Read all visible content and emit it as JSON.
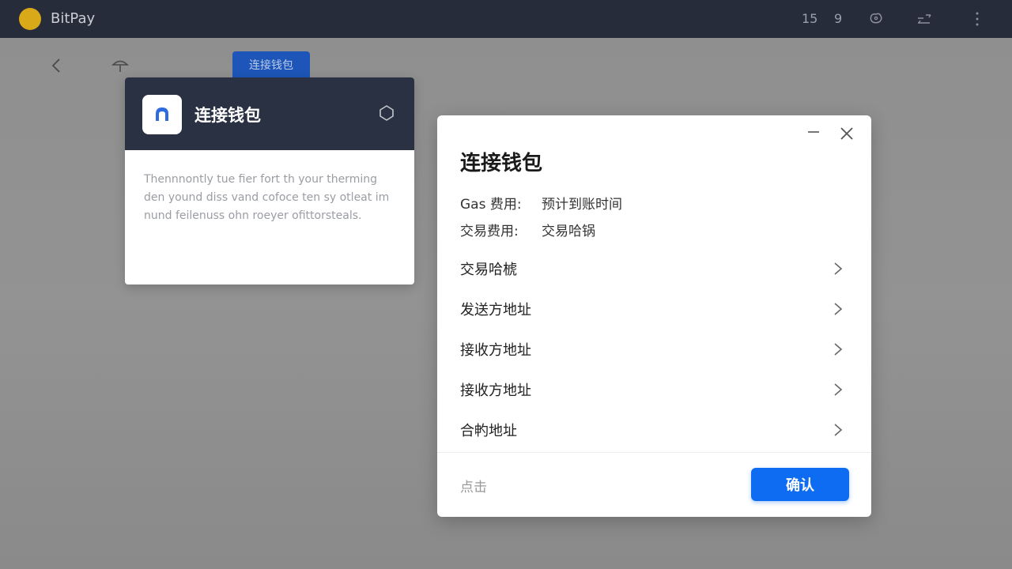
{
  "app": {
    "title": "BitPay",
    "top_num_1": "15",
    "top_num_2": "9",
    "brand_color": "#d9a91a"
  },
  "toolbar": {
    "connect_tab": "连接钱包"
  },
  "left_card": {
    "title": "连接钱包",
    "body_line_1": "Thennnontly tue fier fort th your therming",
    "body_line_2": "den yound diss vand cofoce ten sy otleat im",
    "body_line_3": "nund feilenuss ohn roeyer ofittorsteals."
  },
  "modal": {
    "title": "连接钱包",
    "info": [
      {
        "label": "Gas 费用:",
        "value": "预计到账时间"
      },
      {
        "label": "交易费用:",
        "value": "交易哈锅"
      }
    ],
    "rows": [
      {
        "label": "交易哈椃"
      },
      {
        "label": "发送方地址"
      },
      {
        "label": "接收方地址"
      },
      {
        "label": "接收方地址"
      },
      {
        "label": "合畃地址"
      }
    ],
    "footer_text": "点击",
    "confirm_label": "确认",
    "accent_color": "#0d6cf2"
  }
}
